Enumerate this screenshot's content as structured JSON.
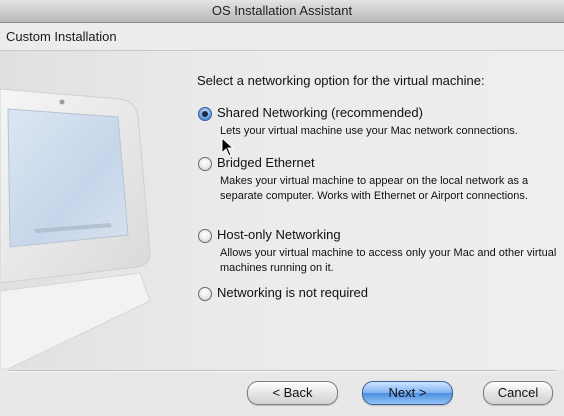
{
  "window": {
    "title": "OS Installation Assistant"
  },
  "header": {
    "title": "Custom Installation"
  },
  "main": {
    "prompt": "Select a networking option for the virtual machine:",
    "options": [
      {
        "label": "Shared Networking (recommended)",
        "description": "Lets your virtual machine use your Mac network connections.",
        "selected": true
      },
      {
        "label": "Bridged Ethernet",
        "description": "Makes your virtual machine to appear on the local network as a separate computer. Works with Ethernet or Airport connections.",
        "selected": false
      },
      {
        "label": "Host-only Networking",
        "description": "Allows your virtual machine to access only your Mac and other virtual machines running on it.",
        "selected": false
      },
      {
        "label": "Networking is not required",
        "description": "",
        "selected": false
      }
    ]
  },
  "buttons": {
    "back": "< Back",
    "next": "Next >",
    "cancel": "Cancel"
  },
  "icons": {
    "illustration": "imac-computer-illustration",
    "cursor": "mouse-pointer-icon"
  },
  "colors": {
    "accent": "#4e8fe0",
    "background": "#e8e8e8"
  }
}
